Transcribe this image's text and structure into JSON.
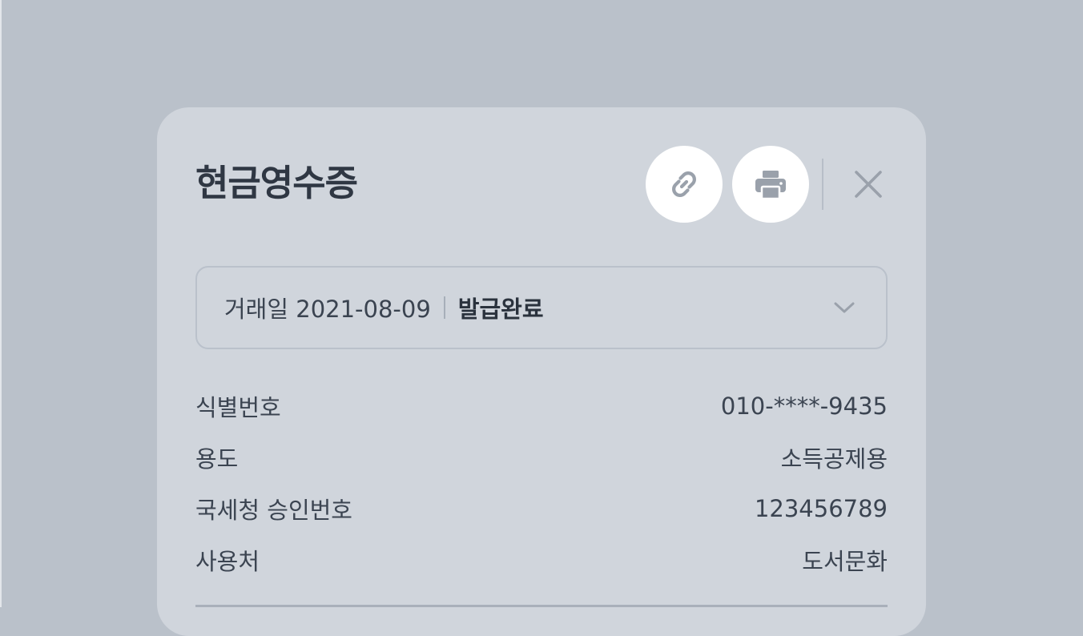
{
  "modal": {
    "title": "현금영수증",
    "link_icon": "link-icon",
    "print_icon": "printer-icon",
    "close_icon": "close-icon"
  },
  "select": {
    "date_text": "거래일 2021-08-09",
    "status_text": "발급완료",
    "chevron_icon": "chevron-down-icon"
  },
  "details": [
    {
      "label": "식별번호",
      "value": "010-****-9435"
    },
    {
      "label": "용도",
      "value": "소득공제용"
    },
    {
      "label": "국세청 승인번호",
      "value": "123456789"
    },
    {
      "label": "사용처",
      "value": "도서문화"
    }
  ],
  "colors": {
    "backdrop": "#bac1ca",
    "modal_bg": "#d0d5dc",
    "title_text": "#2f3743",
    "icon_gray": "#9aa1ab"
  }
}
